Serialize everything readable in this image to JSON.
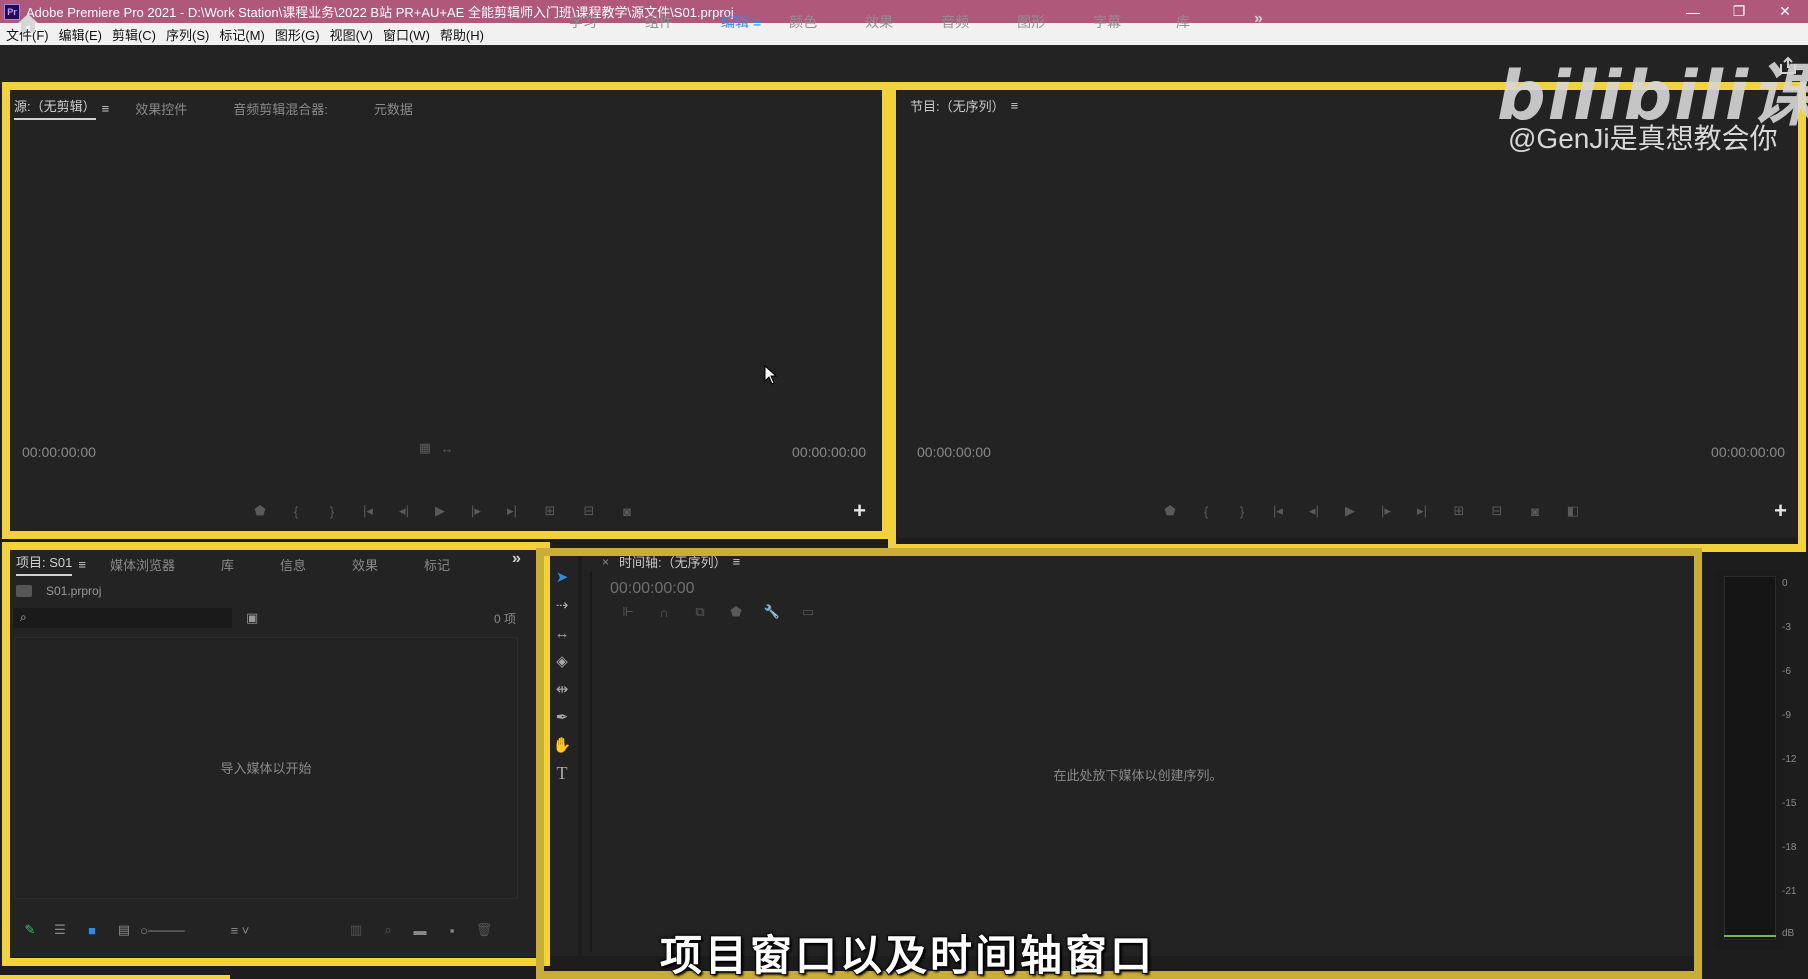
{
  "titlebar": {
    "app_icon": "Pr",
    "title": "Adobe Premiere Pro 2021 - D:\\Work Station\\课程业务\\2022 B站 PR+AU+AE 全能剪辑师入门班\\课程教学\\源文件\\S01.prproj",
    "minimize": "—",
    "restore": "❐",
    "close": "✕"
  },
  "menu": [
    "文件(F)",
    "编辑(E)",
    "剪辑(C)",
    "序列(S)",
    "标记(M)",
    "图形(G)",
    "视图(V)",
    "窗口(W)",
    "帮助(H)"
  ],
  "workspaces": {
    "tabs": [
      "学习",
      "组件",
      "编辑",
      "颜色",
      "效果",
      "音频",
      "图形",
      "字幕",
      "库"
    ],
    "active": "编辑",
    "more": "»"
  },
  "watermark": {
    "logo": "bilibili课堂",
    "user": "@GenJi是真想教会你"
  },
  "source_panel": {
    "tabs": [
      "源:（无剪辑）",
      "效果控件",
      "音频剪辑混合器:",
      "元数据"
    ],
    "menu_icon": "≡",
    "timecode_left": "00:00:00:00",
    "timecode_right": "00:00:00:00",
    "add_button": "+"
  },
  "program_panel": {
    "title": "节目:（无序列）",
    "menu_icon": "≡",
    "timecode_left": "00:00:00:00",
    "timecode_right": "00:00:00:00",
    "add_button": "+"
  },
  "project_panel": {
    "tabs": [
      "项目: S01",
      "媒体浏览器",
      "库",
      "信息",
      "效果",
      "标记"
    ],
    "menu_icon": "≡",
    "more": "»",
    "file_name": "S01.prproj",
    "search_placeholder": "",
    "item_count": "0 项",
    "empty_message": "导入媒体以开始"
  },
  "timeline_panel": {
    "close": "×",
    "title": "时间轴:（无序列）",
    "menu_icon": "≡",
    "timecode": "00:00:00:00",
    "empty_message": "在此处放下媒体以创建序列。"
  },
  "meter": {
    "ticks": [
      "0",
      "-3",
      "-6",
      "-9",
      "-12",
      "-15",
      "-18",
      "-21",
      "dB"
    ]
  },
  "subtitle": "项目窗口以及时间轴窗口",
  "colors": {
    "highlight": "#f2d23b",
    "accent": "#2d8ceb",
    "titlebar": "#b0587a"
  }
}
